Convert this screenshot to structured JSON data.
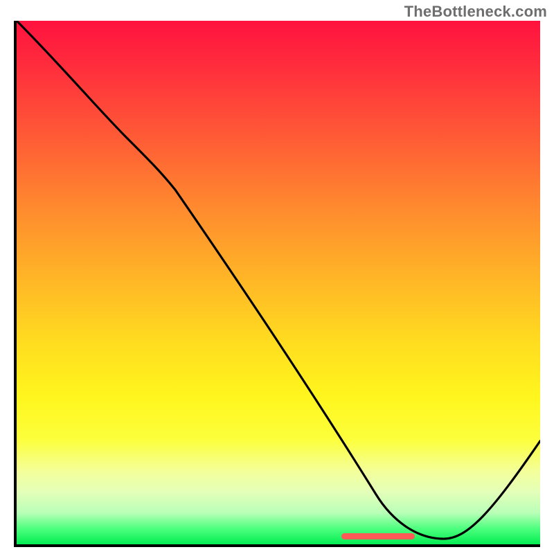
{
  "watermark": "TheBottleneck.com",
  "colors": {
    "gradient_top": "#ff123e",
    "gradient_mid": "#ffde1f",
    "gradient_bottom": "#03ed52",
    "axis": "#000000",
    "curve": "#000000",
    "optimal_marker": "#ff5a55"
  },
  "chart_data": {
    "type": "line",
    "title": "",
    "xlabel": "",
    "ylabel": "",
    "xlim": [
      0,
      100
    ],
    "ylim": [
      0,
      100
    ],
    "x": [
      0,
      20,
      70,
      85,
      100
    ],
    "values": [
      100,
      79,
      6,
      0,
      20
    ],
    "optimal_range_pct": [
      62,
      76
    ],
    "annotations": [],
    "grid": false,
    "legend": false
  }
}
